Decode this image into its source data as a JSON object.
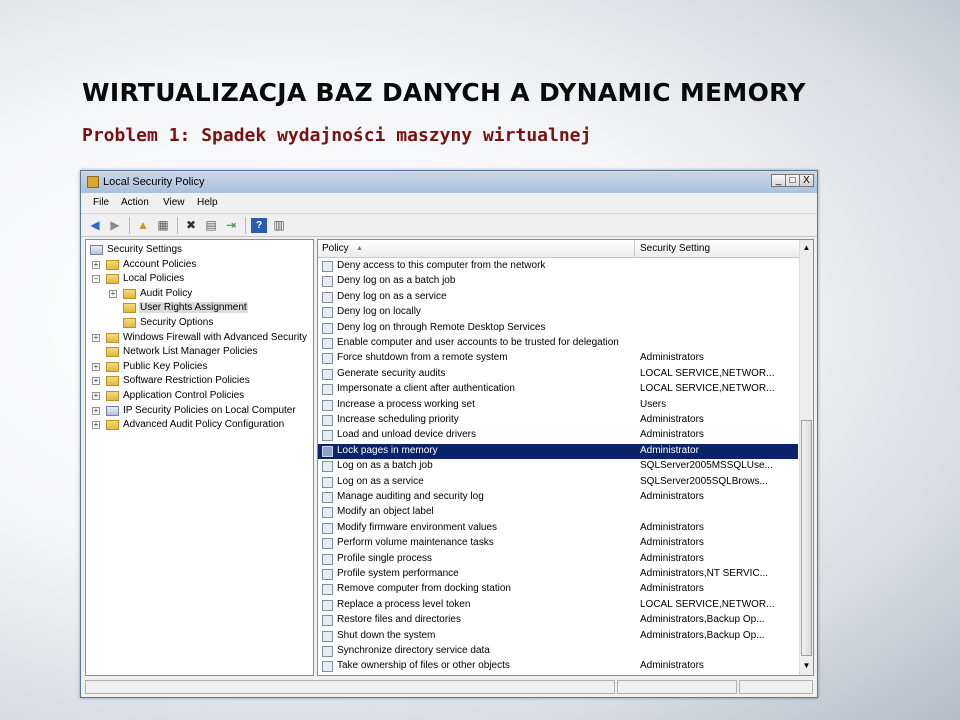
{
  "slide": {
    "title": "WIRTUALIZACJA BAZ DANYCH A DYNAMIC MEMORY",
    "subtitle": "Problem 1: Spadek wydajności maszyny wirtualnej"
  },
  "window": {
    "title": "Local Security Policy",
    "controls": {
      "minimize": "_",
      "maximize": "□",
      "close": "X"
    },
    "menu": [
      "File",
      "Action",
      "View",
      "Help"
    ],
    "toolbar_icons": [
      "back-icon",
      "forward-icon",
      "up-folder-icon",
      "show-hide-tree-icon",
      "delete-icon",
      "properties-icon",
      "export-list-icon",
      "help-icon",
      "description-icon"
    ]
  },
  "tree": {
    "items": [
      {
        "label": "Security Settings",
        "expander": "",
        "icon": "shield-icon",
        "selected": false
      },
      {
        "label": "Account Policies",
        "expander": "+",
        "icon": "folder-icon",
        "selected": false
      },
      {
        "label": "Local Policies",
        "expander": "−",
        "icon": "folder-icon",
        "selected": false
      },
      {
        "label": "Audit Policy",
        "expander": "+",
        "icon": "folder-icon",
        "selected": false
      },
      {
        "label": "User Rights Assignment",
        "expander": "",
        "icon": "folder-icon",
        "selected": true
      },
      {
        "label": "Security Options",
        "expander": "",
        "icon": "folder-icon",
        "selected": false
      },
      {
        "label": "Windows Firewall with Advanced Security",
        "expander": "+",
        "icon": "folder-icon",
        "selected": false
      },
      {
        "label": "Network List Manager Policies",
        "expander": "",
        "icon": "folder-icon",
        "selected": false
      },
      {
        "label": "Public Key Policies",
        "expander": "+",
        "icon": "folder-icon",
        "selected": false
      },
      {
        "label": "Software Restriction Policies",
        "expander": "+",
        "icon": "folder-icon",
        "selected": false
      },
      {
        "label": "Application Control Policies",
        "expander": "+",
        "icon": "folder-icon",
        "selected": false
      },
      {
        "label": "IP Security Policies on Local Computer",
        "expander": "+",
        "icon": "shield-icon",
        "selected": false
      },
      {
        "label": "Advanced Audit Policy Configuration",
        "expander": "+",
        "icon": "folder-icon",
        "selected": false
      }
    ]
  },
  "list": {
    "columns": {
      "policy": "Policy",
      "setting": "Security Setting"
    },
    "sort_indicator": "▲",
    "rows": [
      {
        "policy": "Deny access to this computer from the network",
        "setting": ""
      },
      {
        "policy": "Deny log on as a batch job",
        "setting": ""
      },
      {
        "policy": "Deny log on as a service",
        "setting": ""
      },
      {
        "policy": "Deny log on locally",
        "setting": ""
      },
      {
        "policy": "Deny log on through Remote Desktop Services",
        "setting": ""
      },
      {
        "policy": "Enable computer and user accounts to be trusted for delegation",
        "setting": ""
      },
      {
        "policy": "Force shutdown from a remote system",
        "setting": "Administrators"
      },
      {
        "policy": "Generate security audits",
        "setting": "LOCAL SERVICE,NETWOR..."
      },
      {
        "policy": "Impersonate a client after authentication",
        "setting": "LOCAL SERVICE,NETWOR..."
      },
      {
        "policy": "Increase a process working set",
        "setting": "Users"
      },
      {
        "policy": "Increase scheduling priority",
        "setting": "Administrators"
      },
      {
        "policy": "Load and unload device drivers",
        "setting": "Administrators"
      },
      {
        "policy": "Lock pages in memory",
        "setting": "Administrator",
        "selected": true
      },
      {
        "policy": "Log on as a batch job",
        "setting": "SQLServer2005MSSQLUse..."
      },
      {
        "policy": "Log on as a service",
        "setting": "SQLServer2005SQLBrows..."
      },
      {
        "policy": "Manage auditing and security log",
        "setting": "Administrators"
      },
      {
        "policy": "Modify an object label",
        "setting": ""
      },
      {
        "policy": "Modify firmware environment values",
        "setting": "Administrators"
      },
      {
        "policy": "Perform volume maintenance tasks",
        "setting": "Administrators"
      },
      {
        "policy": "Profile single process",
        "setting": "Administrators"
      },
      {
        "policy": "Profile system performance",
        "setting": "Administrators,NT SERVIC..."
      },
      {
        "policy": "Remove computer from docking station",
        "setting": "Administrators"
      },
      {
        "policy": "Replace a process level token",
        "setting": "LOCAL SERVICE,NETWOR..."
      },
      {
        "policy": "Restore files and directories",
        "setting": "Administrators,Backup Op..."
      },
      {
        "policy": "Shut down the system",
        "setting": "Administrators,Backup Op..."
      },
      {
        "policy": "Synchronize directory service data",
        "setting": ""
      },
      {
        "policy": "Take ownership of files or other objects",
        "setting": "Administrators"
      }
    ]
  },
  "scrollbar": {
    "up": "▲",
    "down": "▼"
  }
}
